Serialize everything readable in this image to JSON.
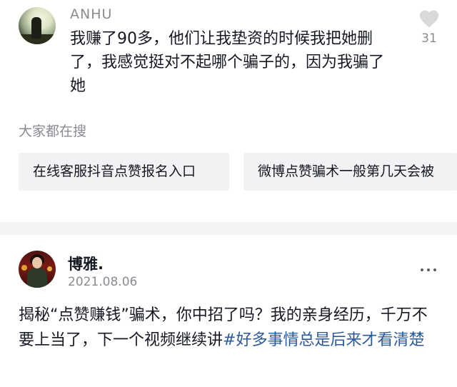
{
  "comment": {
    "username": "ANHU",
    "text": "我赚了90多，他们让我垫资的时候我把她删了，我感觉挺对不起哪个骗子的，因为我骗了她",
    "like_icon": "heart-icon",
    "like_count": "31"
  },
  "search": {
    "title": "大家都在搜",
    "chips": [
      "在线客服抖音点赞报名入口",
      "微博点赞骗术一般第几天会被"
    ]
  },
  "post": {
    "username": "博雅.",
    "date": "2021.08.06",
    "more_icon": "more-icon",
    "text": "揭秘“点赞赚钱”骗术，你中招了吗？我的亲身经历，千万不要上当了，下一个视频继续讲",
    "hashtag": "#好多事情总是后来才看清楚"
  },
  "colors": {
    "secondary_text": "#8a8b91",
    "chip_bg": "#f2f2f4",
    "hashtag": "#2b5a9a",
    "divider": "#f3f3f4"
  }
}
